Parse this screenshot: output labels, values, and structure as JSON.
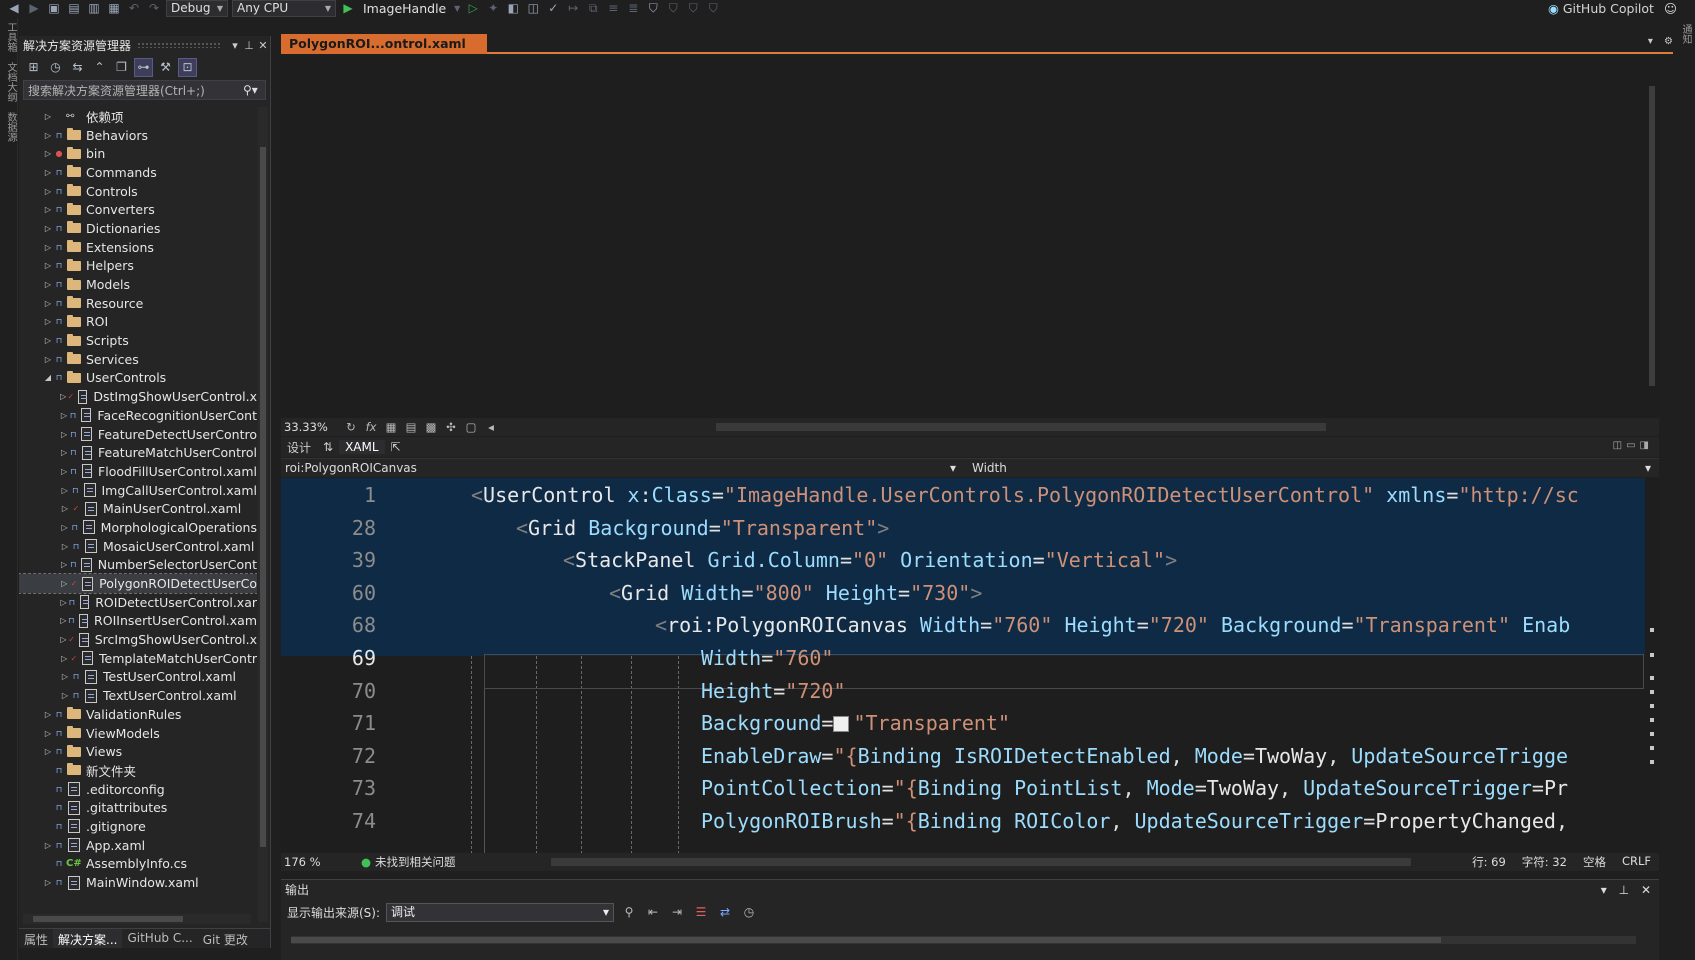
{
  "toolbar": {
    "config": "Debug",
    "platform": "Any CPU",
    "run_target": "ImageHandle",
    "copilot": "GitHub Copilot"
  },
  "left_strip": {
    "items": [
      "工具箱",
      "文档大纲",
      "数据源"
    ]
  },
  "right_strip": {
    "items": [
      "通知"
    ]
  },
  "solution_explorer": {
    "title": "解决方案资源管理器",
    "search_placeholder": "搜索解决方案资源管理器(Ctrl+;)",
    "tree": [
      {
        "label": "依赖项",
        "type": "ref",
        "level": 1
      },
      {
        "label": "Behaviors",
        "type": "folder",
        "level": 1
      },
      {
        "label": "bin",
        "type": "folder",
        "level": 1,
        "status": "red"
      },
      {
        "label": "Commands",
        "type": "folder",
        "level": 1
      },
      {
        "label": "Controls",
        "type": "folder",
        "level": 1
      },
      {
        "label": "Converters",
        "type": "folder",
        "level": 1
      },
      {
        "label": "Dictionaries",
        "type": "folder",
        "level": 1
      },
      {
        "label": "Extensions",
        "type": "folder",
        "level": 1
      },
      {
        "label": "Helpers",
        "type": "folder",
        "level": 1
      },
      {
        "label": "Models",
        "type": "folder",
        "level": 1
      },
      {
        "label": "Resource",
        "type": "folder",
        "level": 1
      },
      {
        "label": "ROI",
        "type": "folder",
        "level": 1
      },
      {
        "label": "Scripts",
        "type": "folder",
        "level": 1
      },
      {
        "label": "Services",
        "type": "folder",
        "level": 1
      },
      {
        "label": "UserControls",
        "type": "folder",
        "level": 1,
        "expanded": true
      },
      {
        "label": "DstImgShowUserControl.x",
        "type": "file",
        "level": 2,
        "status": "check"
      },
      {
        "label": "FaceRecognitionUserCont",
        "type": "file",
        "level": 2
      },
      {
        "label": "FeatureDetectUserContro",
        "type": "file",
        "level": 2
      },
      {
        "label": "FeatureMatchUserControl",
        "type": "file",
        "level": 2
      },
      {
        "label": "FloodFillUserControl.xaml",
        "type": "file",
        "level": 2
      },
      {
        "label": "ImgCallUserControl.xaml",
        "type": "file",
        "level": 2
      },
      {
        "label": "MainUserControl.xaml",
        "type": "file",
        "level": 2,
        "status": "check"
      },
      {
        "label": "MorphologicalOperations",
        "type": "file",
        "level": 2
      },
      {
        "label": "MosaicUserControl.xaml",
        "type": "file",
        "level": 2
      },
      {
        "label": "NumberSelectorUserCont",
        "type": "file",
        "level": 2
      },
      {
        "label": "PolygonROIDetectUserCo",
        "type": "file",
        "level": 2,
        "status": "check",
        "selected": true
      },
      {
        "label": "ROIDetectUserControl.xar",
        "type": "file",
        "level": 2
      },
      {
        "label": "ROIInsertUserControl.xam",
        "type": "file",
        "level": 2
      },
      {
        "label": "SrcImgShowUserControl.x",
        "type": "file",
        "level": 2,
        "status": "check"
      },
      {
        "label": "TemplateMatchUserContr",
        "type": "file",
        "level": 2,
        "status": "check"
      },
      {
        "label": "TestUserControl.xaml",
        "type": "file",
        "level": 2
      },
      {
        "label": "TextUserControl.xaml",
        "type": "file",
        "level": 2
      },
      {
        "label": "ValidationRules",
        "type": "folder",
        "level": 1
      },
      {
        "label": "ViewModels",
        "type": "folder",
        "level": 1
      },
      {
        "label": "Views",
        "type": "folder",
        "level": 1
      },
      {
        "label": "新文件夹",
        "type": "folder",
        "level": 1,
        "noexp": true
      },
      {
        "label": ".editorconfig",
        "type": "file",
        "level": 1,
        "noexp": true
      },
      {
        "label": ".gitattributes",
        "type": "file",
        "level": 1,
        "noexp": true
      },
      {
        "label": ".gitignore",
        "type": "file",
        "level": 1,
        "noexp": true
      },
      {
        "label": "App.xaml",
        "type": "file",
        "level": 1
      },
      {
        "label": "AssemblyInfo.cs",
        "type": "cs",
        "level": 1,
        "noexp": true
      },
      {
        "label": "MainWindow.xaml",
        "type": "file",
        "level": 1
      }
    ],
    "bottom_tabs": [
      "属性",
      "解决方案...",
      "GitHub C...",
      "Git 更改"
    ]
  },
  "editor": {
    "tab_title": "PolygonROI...ontrol.xaml",
    "design_zoom": "33.33%",
    "split_tabs": {
      "design": "设计",
      "swap": "⇅",
      "xaml": "XAML"
    },
    "nav_left": "roi:PolygonROICanvas",
    "nav_right": "Width",
    "code_zoom": "176 %",
    "issues": "未找到相关问题",
    "status": {
      "line": "行: 69",
      "char": "字符: 32",
      "space": "空格",
      "eol": "CRLF"
    }
  },
  "code_lines": [
    {
      "n": "1",
      "sticky": true,
      "indent": 0,
      "parts": [
        [
          "tg",
          "<"
        ],
        [
          "el",
          "UserControl "
        ],
        [
          "at",
          "x"
        ],
        [
          "pn",
          ":"
        ],
        [
          "at",
          "Class"
        ],
        [
          "pn",
          "="
        ],
        [
          "st2",
          "\"ImageHandle.UserControls.PolygonROIDetectUserControl\""
        ],
        [
          "pn",
          " "
        ],
        [
          "at",
          "xmlns"
        ],
        [
          "pn",
          "="
        ],
        [
          "st2",
          "\"http://sc"
        ]
      ]
    },
    {
      "n": "28",
      "sticky": true,
      "indent": 1,
      "parts": [
        [
          "tg",
          "<"
        ],
        [
          "el",
          "Grid "
        ],
        [
          "at",
          "Background"
        ],
        [
          "pn",
          "="
        ],
        [
          "st2",
          "\"Transparent\""
        ],
        [
          "tg",
          ">"
        ]
      ]
    },
    {
      "n": "39",
      "sticky": true,
      "indent": 2,
      "parts": [
        [
          "tg",
          "<"
        ],
        [
          "el",
          "StackPanel "
        ],
        [
          "at",
          "Grid.Column"
        ],
        [
          "pn",
          "="
        ],
        [
          "st2",
          "\"0\""
        ],
        [
          "pn",
          " "
        ],
        [
          "at",
          "Orientation"
        ],
        [
          "pn",
          "="
        ],
        [
          "st2",
          "\"Vertical\""
        ],
        [
          "tg",
          ">"
        ]
      ]
    },
    {
      "n": "60",
      "sticky": true,
      "indent": 3,
      "parts": [
        [
          "tg",
          "<"
        ],
        [
          "el",
          "Grid "
        ],
        [
          "at",
          "Width"
        ],
        [
          "pn",
          "="
        ],
        [
          "st2",
          "\"800\""
        ],
        [
          "pn",
          " "
        ],
        [
          "at",
          "Height"
        ],
        [
          "pn",
          "="
        ],
        [
          "st2",
          "\"730\""
        ],
        [
          "tg",
          ">"
        ]
      ]
    },
    {
      "n": "68",
      "sticky": true,
      "indent": 4,
      "parts": [
        [
          "tg",
          "<"
        ],
        [
          "el",
          "roi"
        ],
        [
          "pn",
          ":"
        ],
        [
          "el",
          "PolygonROICanvas "
        ],
        [
          "at",
          "Width"
        ],
        [
          "pn",
          "="
        ],
        [
          "st2",
          "\"760\""
        ],
        [
          "pn",
          " "
        ],
        [
          "at",
          "Height"
        ],
        [
          "pn",
          "="
        ],
        [
          "st2",
          "\"720\""
        ],
        [
          "pn",
          " "
        ],
        [
          "at",
          "Background"
        ],
        [
          "pn",
          "="
        ],
        [
          "st2",
          "\"Transparent\""
        ],
        [
          "pn",
          " "
        ],
        [
          "at",
          "Enab"
        ]
      ]
    },
    {
      "n": "69",
      "current": true,
      "indent": 5,
      "parts": [
        [
          "at",
          "Width"
        ],
        [
          "pn",
          "="
        ],
        [
          "st2",
          "\"760\""
        ]
      ]
    },
    {
      "n": "70",
      "indent": 5,
      "parts": [
        [
          "at",
          "Height"
        ],
        [
          "pn",
          "="
        ],
        [
          "st2",
          "\"720\""
        ]
      ]
    },
    {
      "n": "71",
      "indent": 5,
      "color_box": true,
      "parts": [
        [
          "at",
          "Background"
        ],
        [
          "pn",
          "="
        ],
        [
          "box",
          ""
        ],
        [
          "st2",
          "\"Transparent\""
        ]
      ]
    },
    {
      "n": "72",
      "indent": 5,
      "parts": [
        [
          "at",
          "EnableDraw"
        ],
        [
          "pn",
          "="
        ],
        [
          "st2",
          "\"{"
        ],
        [
          "at",
          "Binding "
        ],
        [
          "kw",
          "IsROIDetectEnabled"
        ],
        [
          "pn",
          ", "
        ],
        [
          "at",
          "Mode"
        ],
        [
          "pn",
          "="
        ],
        [
          "el",
          "TwoWay"
        ],
        [
          "pn",
          ", "
        ],
        [
          "at",
          "UpdateSourceTrigge"
        ]
      ]
    },
    {
      "n": "73",
      "indent": 5,
      "parts": [
        [
          "at",
          "PointCollection"
        ],
        [
          "pn",
          "="
        ],
        [
          "st2",
          "\"{"
        ],
        [
          "at",
          "Binding "
        ],
        [
          "kw",
          "PointList"
        ],
        [
          "pn",
          ", "
        ],
        [
          "at",
          "Mode"
        ],
        [
          "pn",
          "="
        ],
        [
          "el",
          "TwoWay"
        ],
        [
          "pn",
          ", "
        ],
        [
          "at",
          "UpdateSourceTrigger"
        ],
        [
          "pn",
          "="
        ],
        [
          "el",
          "Pr"
        ]
      ]
    },
    {
      "n": "74",
      "indent": 5,
      "parts": [
        [
          "at",
          "PolygonROIBrush"
        ],
        [
          "pn",
          "="
        ],
        [
          "st2",
          "\"{"
        ],
        [
          "at",
          "Binding "
        ],
        [
          "kw",
          "ROIColor"
        ],
        [
          "pn",
          ", "
        ],
        [
          "at",
          "UpdateSourceTrigger"
        ],
        [
          "pn",
          "="
        ],
        [
          "el",
          "PropertyChanged"
        ],
        [
          "pn",
          ","
        ]
      ]
    }
  ],
  "output": {
    "title": "输出",
    "source_label": "显示输出来源(S):",
    "source_value": "调试"
  }
}
